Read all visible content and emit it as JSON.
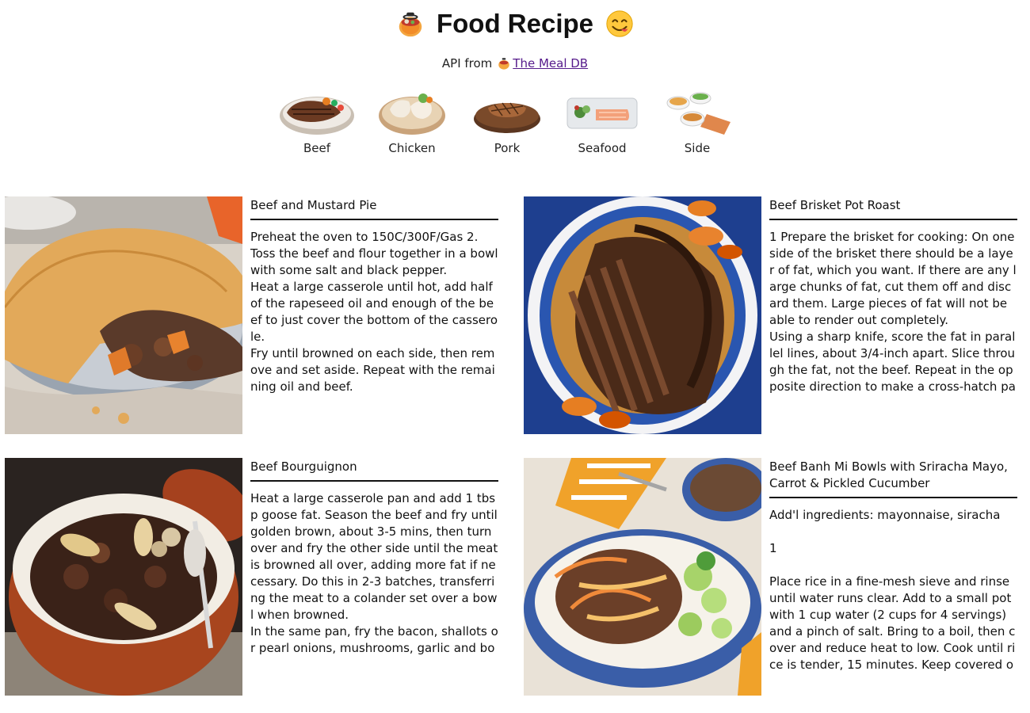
{
  "header": {
    "title": "Food Recipe",
    "api_prefix": "API from",
    "api_link": "The Meal DB"
  },
  "categories": [
    {
      "label": "Beef",
      "icon": "beef-dish-icon"
    },
    {
      "label": "Chicken",
      "icon": "chicken-dish-icon"
    },
    {
      "label": "Pork",
      "icon": "pork-dish-icon"
    },
    {
      "label": "Seafood",
      "icon": "seafood-dish-icon"
    },
    {
      "label": "Side",
      "icon": "side-dish-icon"
    }
  ],
  "recipes": [
    {
      "name": "Beef and Mustard Pie",
      "description": "Preheat the oven to 150C/300F/Gas 2.\nToss the beef and flour together in a bowl with some salt and black pepper.\nHeat a large casserole until hot, add half of the rapeseed oil and enough of the beef to just cover the bottom of the casserole.\nFry until browned on each side, then remove and set aside. Repeat with the remaining oil and beef.\nReturn the beef to the pan, add the win..."
    },
    {
      "name": "Beef Brisket Pot Roast",
      "description": "1 Prepare the brisket for cooking: On one side of the brisket there should be a layer of fat, which you want. If there are any large chunks of fat, cut them off and discard them. Large pieces of fat will not be able to render out completely.\nUsing a sharp knife, score the fat in parallel lines, about 3/4-inch apart. Slice through the fat, not the beef. Repeat in the opposite direction to make a cross-hatch patt..."
    },
    {
      "name": "Beef Bourguignon",
      "description": "Heat a large casserole pan and add 1 tbsp goose fat. Season the beef and fry until golden brown, about 3-5 mins, then turn over and fry the other side until the meat is browned all over, adding more fat if necessary. Do this in 2-3 batches, transferring the meat to a colander set over a bowl when browned.\nIn the same pan, fry the bacon, shallots or pearl onions, mushrooms, garlic and bou..."
    },
    {
      "name": "Beef Banh Mi Bowls with Sriracha Mayo, Carrot & Pickled Cucumber",
      "description": "Add'l ingredients: mayonnaise, siracha\n\n1\n\nPlace rice in a fine-mesh sieve and rinse until water runs clear. Add to a small pot with 1 cup water (2 cups for 4 servings) and a pinch of salt. Bring to a boil, then cover and reduce heat to low. Cook until rice is tender, 15 minutes. Keep covered off hea..."
    }
  ]
}
